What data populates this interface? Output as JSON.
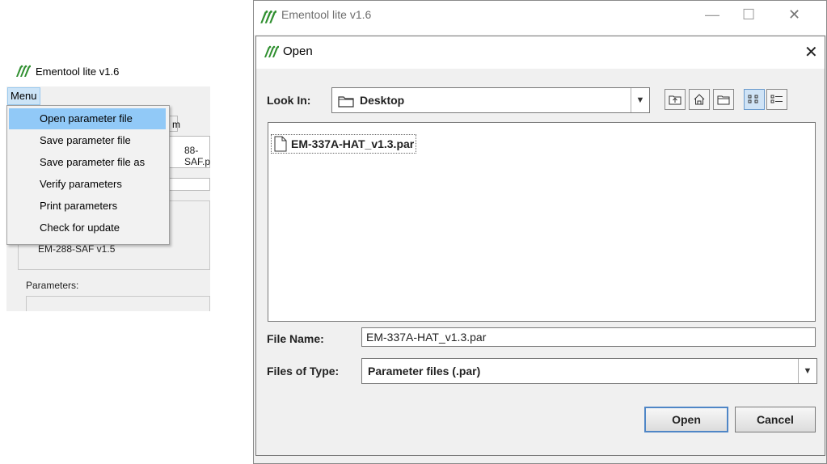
{
  "left_app": {
    "title": "Ementool lite v1.6",
    "menu_label": "Menu",
    "menu_items": [
      {
        "label": "Open parameter file",
        "active": true
      },
      {
        "label": "Save parameter file",
        "active": false
      },
      {
        "label": "Save parameter file as",
        "active": false
      },
      {
        "label": "Verify parameters",
        "active": false
      },
      {
        "label": "Print parameters",
        "active": false
      },
      {
        "label": "Check for update",
        "active": false
      }
    ],
    "bg_fragments": {
      "tab_fragment": "m",
      "file_fragment": "88-SAF.p",
      "device_version": "EM-288-SAF  v1.5",
      "parameters_label": "Parameters:"
    }
  },
  "main_window": {
    "title": "Ementool lite v1.6",
    "controls": {
      "minimize": "—",
      "maximize": "☐",
      "close": "✕"
    }
  },
  "open_dialog": {
    "title": "Open",
    "close": "✕",
    "look_in_label": "Look In:",
    "look_in_value": "Desktop",
    "toolbar": [
      "up-one-level",
      "home",
      "new-folder",
      "list-view",
      "details-view"
    ],
    "files": [
      {
        "name": "EM-337A-HAT_v1.3.par"
      }
    ],
    "file_name_label": "File Name:",
    "file_name_value": "EM-337A-HAT_v1.3.par",
    "files_of_type_label": "Files of Type:",
    "files_of_type_value": "Parameter files (.par)",
    "open_button": "Open",
    "cancel_button": "Cancel"
  },
  "colors": {
    "menu_highlight": "#91c9f7",
    "menu_button_bg": "#cce4f7",
    "logo_green": "#2f8f2f",
    "default_button_border": "#4f86c6"
  }
}
